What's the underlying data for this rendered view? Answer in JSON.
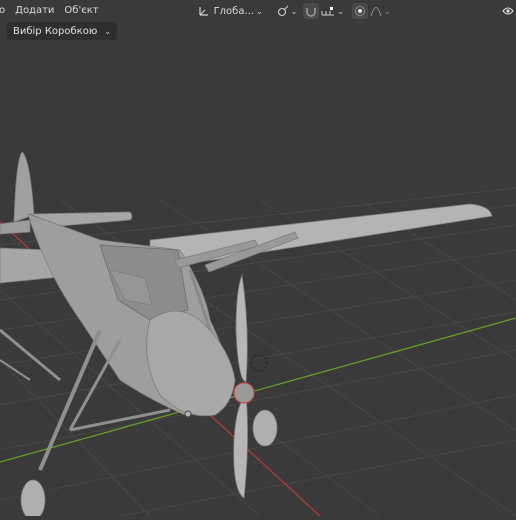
{
  "header": {
    "menus": [
      "о",
      "Додати",
      "Об'єкт"
    ],
    "orientation_label": "Глоба...",
    "orientation_icon": "transform-axes-icon"
  },
  "tool_settings": {
    "selection_mode_label": "Вибір Коробкою"
  },
  "colors": {
    "background": "#3a3a3a",
    "grid_line": "#454545",
    "x_axis": "#b23a3a",
    "y_axis": "#6a9a2a",
    "model": "#a9a9a9"
  }
}
